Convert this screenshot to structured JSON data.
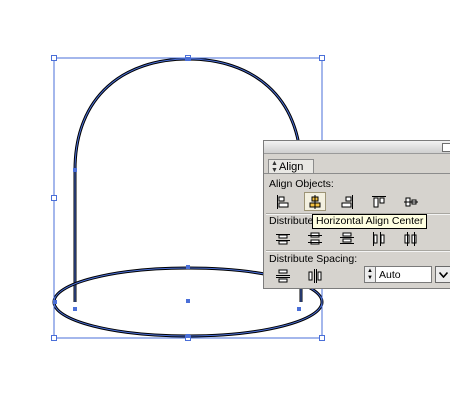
{
  "panel": {
    "tab_label": "Align",
    "align_objects_label": "Align Objects:",
    "distribute_objects_label": "Distribute",
    "distribute_spacing_label": "Distribute Spacing:",
    "spacing_value": "Auto",
    "align_buttons": [
      {
        "name": "horizontal-align-left",
        "active": false
      },
      {
        "name": "horizontal-align-center",
        "active": true
      },
      {
        "name": "horizontal-align-right",
        "active": false
      },
      {
        "name": "vertical-align-top",
        "active": false
      },
      {
        "name": "vertical-align-center",
        "active": false
      }
    ],
    "distribute_buttons": [
      "vertical-distribute-top",
      "vertical-distribute-center",
      "vertical-distribute-bottom",
      "horizontal-distribute-left",
      "horizontal-distribute-center"
    ],
    "spacing_buttons": [
      "vertical-distribute-space",
      "horizontal-distribute-space"
    ]
  },
  "tooltip": {
    "text": "Horizontal Align Center"
  },
  "colors": {
    "selection": "#4a6fd8",
    "shape_stroke": "#000000",
    "panel_bg": "#d6d3ce",
    "tooltip_bg": "#ffffe1"
  }
}
